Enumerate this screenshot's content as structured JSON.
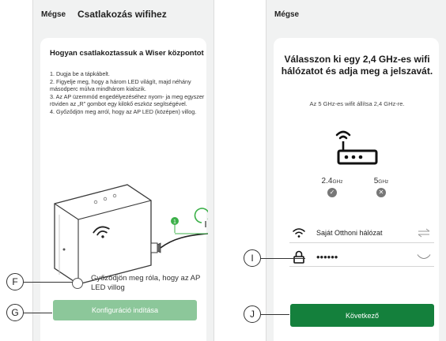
{
  "left_screen": {
    "cancel_label": "Mégse",
    "title": "Csatlakozás wifihez",
    "howto_title": "Hogyan csatlakoztassuk a Wiser központot",
    "steps": [
      "1. Dugja be a tápkábelt.",
      "2. Figyelje meg, hogy a három LED világít, majd néhány másodperc múlva mindhárom kialszik.",
      "3. Az AP üzemmód engedélyezéséhez nyom- ja meg egyszer röviden az „R” gombot egy kilökő eszköz segítségével.",
      "4. Győződjön meg arról, hogy az AP LED (középen) villog."
    ],
    "device_step_badge": "1",
    "checkbox_label": "Győződjön meg róla, hogy az AP LED villog",
    "checkbox_checked": false,
    "config_button_label": "Konfiguráció indítása",
    "config_button_color": "#8cc79a"
  },
  "right_screen": {
    "cancel_label": "Mégse",
    "title": "Válasszon ki egy 2,4 GHz-es wifi hálózatot és adja meg a jelszavát.",
    "subtitle": "Az 5 GHz-es wifit állítsa 2,4 GHz-re.",
    "bands": [
      {
        "value": "2.4",
        "unit": "GHz",
        "status": "check"
      },
      {
        "value": "5",
        "unit": "GHz",
        "status": "cross"
      }
    ],
    "network_name": "Saját Otthoni hálózat",
    "password_masked": "••••••",
    "next_button_label": "Következő",
    "next_button_color": "#14803c"
  },
  "callouts": {
    "f": "F",
    "g": "G",
    "i": "I",
    "j": "J"
  },
  "icons": [
    "wifi-icon",
    "swap-icon",
    "lock-icon",
    "eye-icon",
    "router-icon",
    "check-icon",
    "cross-icon"
  ]
}
